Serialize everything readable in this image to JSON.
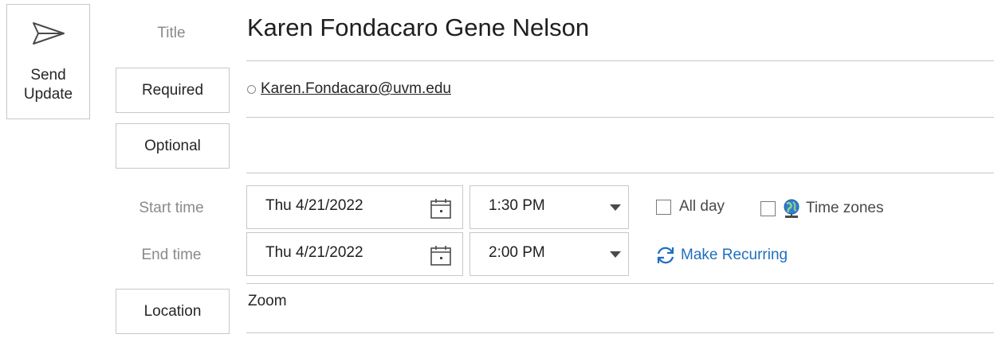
{
  "toolbar": {
    "send_label": "Send\nUpdate"
  },
  "labels": {
    "title": "Title",
    "required": "Required",
    "optional": "Optional",
    "start_time": "Start time",
    "end_time": "End time",
    "location": "Location"
  },
  "meeting": {
    "title": "Karen Fondacaro Gene Nelson",
    "required_attendee": "Karen.Fondacaro@uvm.edu",
    "start_date": "Thu 4/21/2022",
    "start_time": "1:30 PM",
    "end_date": "Thu 4/21/2022",
    "end_time": "2:00 PM",
    "all_day_label": "All day",
    "time_zones_label": "Time zones",
    "make_recurring_label": "Make Recurring",
    "location": "Zoom"
  },
  "colors": {
    "link_blue": "#1e6fc0",
    "label_gray": "#8a8a8a",
    "border_gray": "#c8c8c8"
  },
  "icons": {
    "send": "send-icon",
    "calendar": "calendar-icon",
    "dropdown": "chevron-down-icon",
    "globe": "globe-icon",
    "recurring": "recurring-icon"
  }
}
